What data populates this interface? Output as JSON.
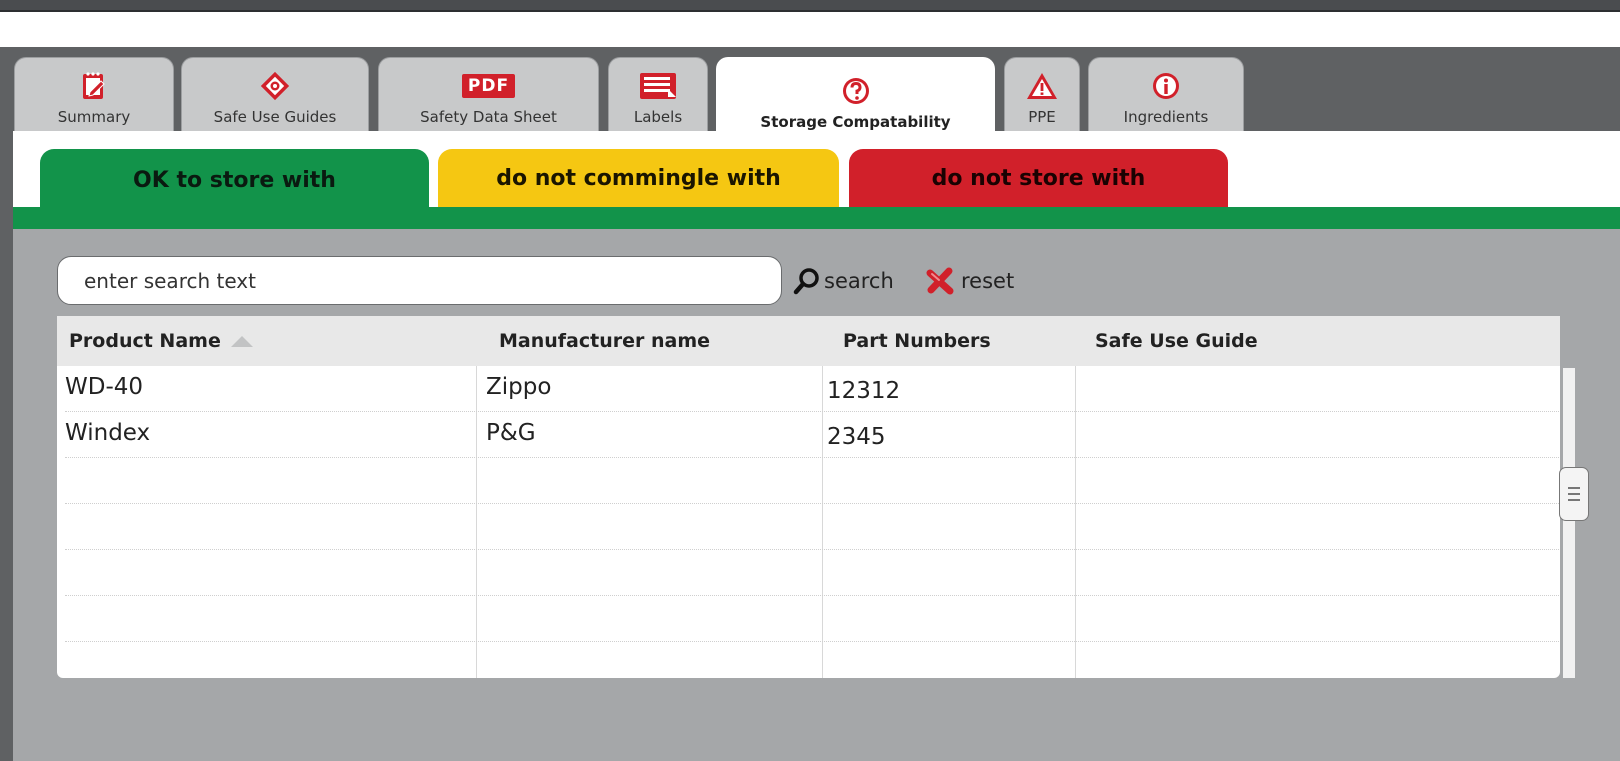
{
  "tabs": [
    {
      "label": "Summary",
      "icon": "notepad-icon"
    },
    {
      "label": "Safe Use Guides",
      "icon": "hazard-diamond-icon"
    },
    {
      "label": "Safety Data Sheet",
      "icon": "pdf-icon",
      "icon_text": "PDF"
    },
    {
      "label": "Labels",
      "icon": "label-sheet-icon"
    },
    {
      "label": "Storage Compatability",
      "icon": "question-circle-icon",
      "active": true
    },
    {
      "label": "PPE",
      "icon": "warning-triangle-icon"
    },
    {
      "label": "Ingredients",
      "icon": "info-circle-icon"
    }
  ],
  "storage_tabs": {
    "ok": "OK to store with",
    "no_commingle": "do not commingle with",
    "no_store": "do not store with"
  },
  "search": {
    "placeholder": "enter search text",
    "search_label": "search",
    "reset_label": "reset"
  },
  "grid": {
    "columns": [
      "Product Name",
      "Manufacturer name",
      "Part Numbers",
      "Safe Use Guide"
    ],
    "sorted_column": "Product Name",
    "rows": [
      {
        "product": "WD-40",
        "manufacturer": "Zippo",
        "part": "12312",
        "guide": ""
      },
      {
        "product": "Windex",
        "manufacturer": "P&G",
        "part": "2345",
        "guide": ""
      }
    ]
  },
  "colors": {
    "green": "#12934a",
    "yellow": "#f5c712",
    "red": "#d1202a",
    "icon_red": "#d1202a"
  }
}
